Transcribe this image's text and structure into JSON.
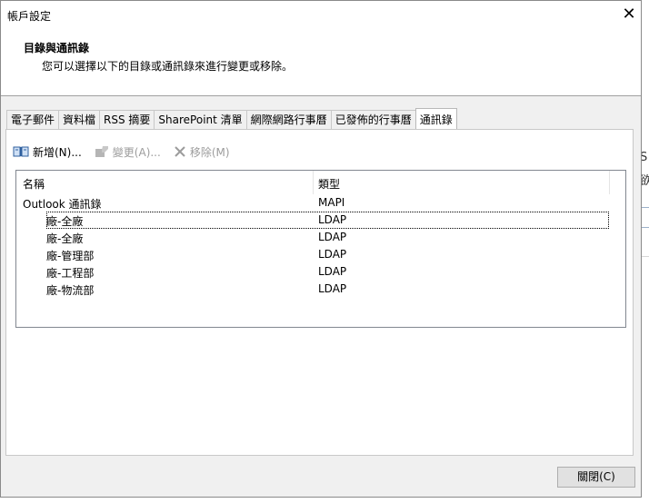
{
  "window": {
    "title": "帳戶設定"
  },
  "header": {
    "title": "目錄與通訊錄",
    "subtitle": "您可以選擇以下的目錄或通訊錄來進行變更或移除。"
  },
  "tabs": [
    {
      "label": "電子郵件"
    },
    {
      "label": "資料檔"
    },
    {
      "label": "RSS 摘要"
    },
    {
      "label": "SharePoint 清單"
    },
    {
      "label": "網際網路行事曆"
    },
    {
      "label": "已發佈的行事曆"
    },
    {
      "label": "通訊錄"
    }
  ],
  "toolbar": {
    "new_label": "新增(N)...",
    "change_label": "變更(A)...",
    "remove_label": "移除(M)"
  },
  "list": {
    "columns": {
      "name": "名稱",
      "type": "類型"
    },
    "rows": [
      {
        "name": "Outlook 通訊錄",
        "type": "MAPI"
      },
      {
        "name": "廠-全廠",
        "type": "LDAP"
      },
      {
        "name": "廠-全廠",
        "type": "LDAP"
      },
      {
        "name": "廠-管理部",
        "type": "LDAP"
      },
      {
        "name": "廠-工程部",
        "type": "LDAP"
      },
      {
        "name": "廠-物流部",
        "type": "LDAP"
      }
    ]
  },
  "footer": {
    "close_label": "關閉(C)"
  },
  "background": {
    "frag1": "S",
    "frag2": "欲"
  },
  "colors": {
    "dialog_bg": "#f0f0f0",
    "panel_bg": "#ffffff",
    "border": "#828790"
  },
  "icons": {
    "new": "address-book-icon",
    "change": "edit-icon",
    "remove": "delete-x-icon",
    "close": "close-icon"
  }
}
